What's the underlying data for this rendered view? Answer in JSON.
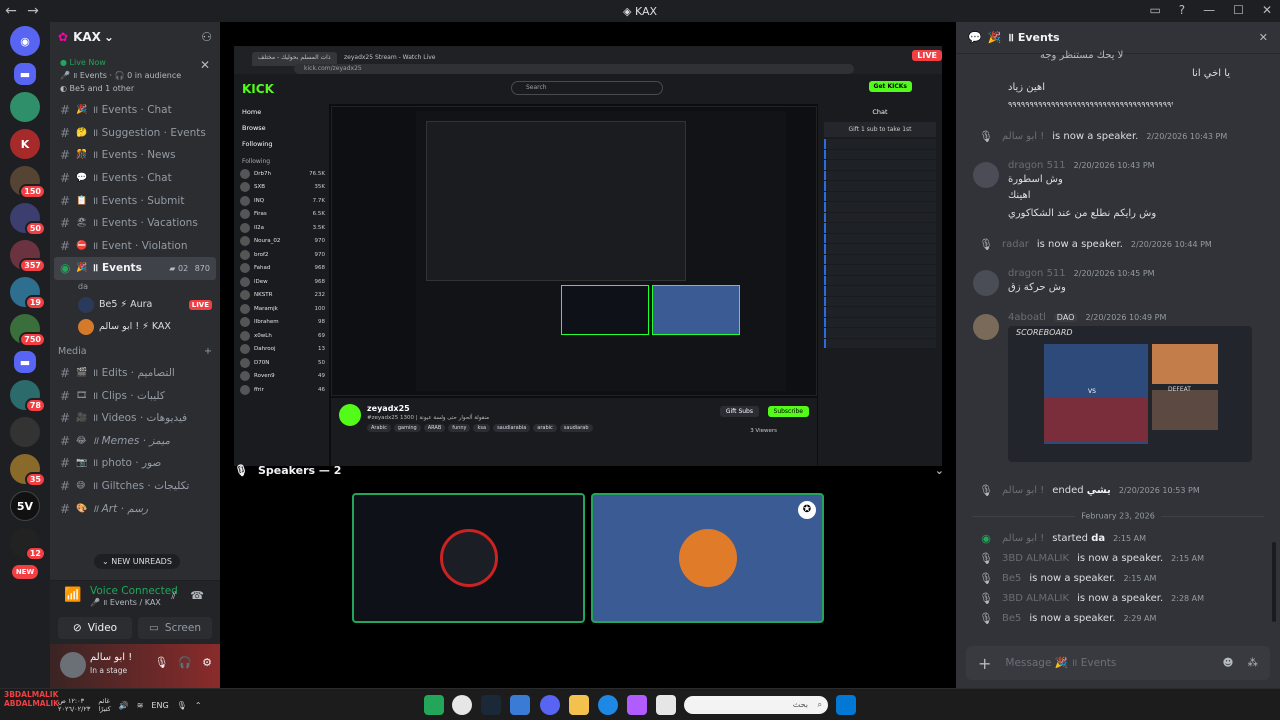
{
  "window": {
    "title": "KAX"
  },
  "rail": {
    "badges": [
      "150",
      "50",
      "357",
      "19",
      "750",
      "78",
      "35",
      "12"
    ],
    "new_label": "NEW"
  },
  "sidebar": {
    "guild_name": "KAX",
    "live_now": {
      "tag": "Live Now",
      "stage_name": "da",
      "channel": "॥ Events",
      "audience": "0 in audience",
      "members": "Be5 and 1 other"
    },
    "channels": [
      {
        "emoji": "🎉",
        "label": "॥ Events · Chat"
      },
      {
        "emoji": "🤔",
        "label": "॥ Suggestion · Events"
      },
      {
        "emoji": "🎊",
        "label": "॥ Events · News"
      },
      {
        "emoji": "💬",
        "label": "॥ Events · Chat"
      },
      {
        "emoji": "📋",
        "label": "॥ Events · Submit"
      },
      {
        "emoji": "🏖",
        "label": "॥ Events · Vacations"
      },
      {
        "emoji": "⛔",
        "label": "॥ Event · Violation"
      }
    ],
    "active_channel": {
      "emoji": "🎉",
      "label": "॥ Events",
      "sub": "da",
      "count_a": "02",
      "count_b": "870"
    },
    "stage_users": [
      {
        "name": "Be5 ⚡ Aura",
        "live": "LIVE"
      },
      {
        "name": "ابو سالم ! ⚡ KAX",
        "live": ""
      }
    ],
    "category": "Media",
    "media_channels": [
      {
        "emoji": "🎬",
        "label": "॥ Edits · التصاميم"
      },
      {
        "emoji": "🎞",
        "label": "॥ Clips · كليبات"
      },
      {
        "emoji": "🎥",
        "label": "॥ Videos · فيديوهات"
      },
      {
        "emoji": "😂",
        "label": "॥ Memes · ميمز"
      },
      {
        "emoji": "📷",
        "label": "॥ photo · صور"
      },
      {
        "emoji": "😅",
        "label": "॥ Giltches · تكليجات"
      },
      {
        "emoji": "🎨",
        "label": "॥ Art · رسم"
      }
    ],
    "new_unreads": "NEW UNREADS",
    "voice": {
      "status": "Voice Connected",
      "sub": "॥ Events / KAX",
      "video_label": "Video",
      "screen_label": "Screen"
    },
    "user": {
      "name": "ابو سالم !",
      "status": "In a stage"
    }
  },
  "stage": {
    "live_chip": "LIVE",
    "browser": {
      "tab1": "ذات المسلم بحوليك - مختلف",
      "tab2": "zeyadx25 Stream - Watch Live",
      "url": "kick.com/zeyadx25"
    },
    "kick": {
      "logo": "KICK",
      "search_placeholder": "Search",
      "get_kicks": "Get KICKs",
      "nav": [
        "Home",
        "Browse",
        "Following"
      ],
      "following_label": "Following",
      "follows": [
        {
          "name": "Drb7h",
          "v": "76.5K"
        },
        {
          "name": "SXB",
          "v": "35K"
        },
        {
          "name": "INQ",
          "v": "7.7K"
        },
        {
          "name": "Firas",
          "v": "6.5K"
        },
        {
          "name": "Il2a",
          "v": "3.5K"
        },
        {
          "name": "Noura_02",
          "v": "970"
        },
        {
          "name": "brof2",
          "v": "970"
        },
        {
          "name": "Fahad",
          "v": "968"
        },
        {
          "name": "lDew",
          "v": "968"
        },
        {
          "name": "NKSTR",
          "v": "232"
        },
        {
          "name": "Maramjk",
          "v": "100"
        },
        {
          "name": "IIbrahem",
          "v": "98"
        },
        {
          "name": "x0wLh",
          "v": "69"
        },
        {
          "name": "Dahrooj",
          "v": "13"
        },
        {
          "name": "D70N",
          "v": "50"
        },
        {
          "name": "Roven9",
          "v": "49"
        },
        {
          "name": "ffrir",
          "v": "46"
        }
      ],
      "chat_header": "Chat",
      "gift_text": "Gift 1 sub to take 1st",
      "streamer": "zeyadx25",
      "stream_title": "#zeyadx25 1300 | منقولة ألحوار حتى ولسة عيونة",
      "tags": [
        "Arabic",
        "gaming",
        "ARAB",
        "funny",
        "ksa",
        "saudiarabia",
        "arabic",
        "saudiarab"
      ],
      "subscribe": "Subscribe",
      "gift_subs": "Gift Subs",
      "viewers": "3 Viewers"
    },
    "speakers_header": "Speakers — 2"
  },
  "chat": {
    "header": "॥ Events",
    "top_lines": [
      "لا يحك مستنظر وجه",
      "يا اخي انا",
      "اهين زياد",
      "٩٩٩٩٩٩٩٩٩٩٩٩٩٩٩٩٩٩٩٩٩٩٩٩٩٩٩٩٩٩٩٩٩٩٩٩٩٩٩٩٩٩٩٩٩٩٩٩٩"
    ],
    "sys1": {
      "who": "ابو سالم !",
      "text": "is now a speaker.",
      "ts": "2/20/2026 10:43 PM"
    },
    "msg1": {
      "who": "dragon 511",
      "ts": "2/20/2026 10:43 PM",
      "lines": [
        "وش اسطورة",
        "اهينك",
        "وش رايكم نطلع من عند الشكاكوري"
      ]
    },
    "sys2": {
      "who": "radar",
      "text": "is now a speaker.",
      "ts": "2/20/2026 10:44 PM"
    },
    "msg2": {
      "who": "dragon 511",
      "ts": "2/20/2026 10:45 PM",
      "lines": [
        "وش حركة زق"
      ]
    },
    "msg3": {
      "who": "4aboatl",
      "tag": "DAO",
      "ts": "2/20/2026 10:49 PM",
      "embed_title": "SCOREBOARD",
      "embed_vs": "VS",
      "embed_result": "DEFEAT"
    },
    "sys3": {
      "who": "ابو سالم !",
      "text": "ended",
      "bold": "يشي",
      "ts": "2/20/2026 10:53 PM"
    },
    "date_divider": "February 23, 2026",
    "sys_list": [
      {
        "who": "ابو سالم !",
        "text": "started",
        "bold": "da",
        "ts": "2:15 AM"
      },
      {
        "who": "3BD ALMALIK",
        "text": "is now a speaker.",
        "bold": "",
        "ts": "2:15 AM"
      },
      {
        "who": "Be5",
        "text": "is now a speaker.",
        "bold": "",
        "ts": "2:15 AM"
      },
      {
        "who": "3BD ALMALIK",
        "text": "is now a speaker.",
        "bold": "",
        "ts": "2:28 AM"
      },
      {
        "who": "Be5",
        "text": "is now a speaker.",
        "bold": "",
        "ts": "2:29 AM"
      }
    ],
    "composer_placeholder": "Message 🎉 ॥ Events"
  },
  "taskbar": {
    "left_name": "3BDALMALIK",
    "left_sub": "ABDALMALIK",
    "clock_top": "١٢:٠٣ ص",
    "clock_bottom": "٢٠٢٦/٠٢/٢٣",
    "weather": "غائم",
    "weather_sub": "كثيرًا",
    "lang": "ENG",
    "search_placeholder": "بحث"
  },
  "colors": {
    "accent": "#5865f2",
    "live": "#f23f43",
    "connected": "#23a55a",
    "kick": "#53fc18"
  }
}
